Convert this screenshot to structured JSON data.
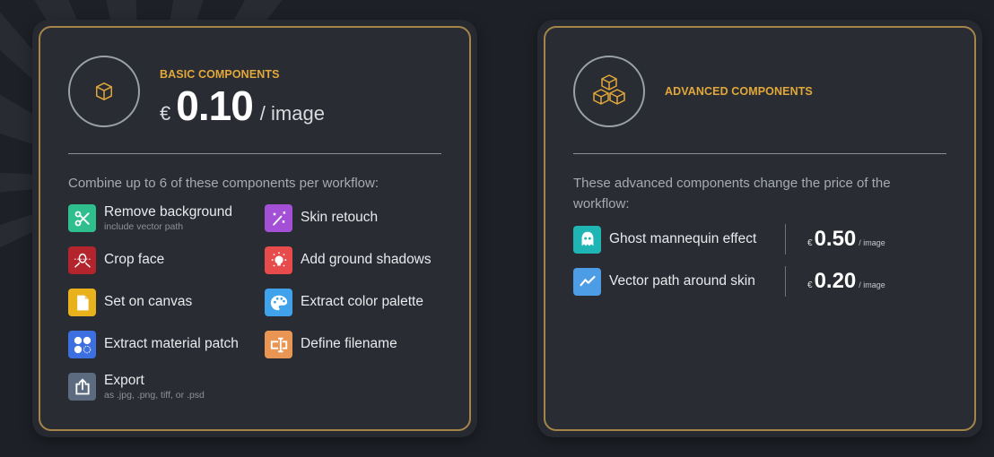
{
  "colors": {
    "accent_gold": "#e3a83a",
    "card_border": "#a5844a",
    "background": "#1d2026",
    "card_bg": "#292d33"
  },
  "basic": {
    "title": "BASIC COMPONENTS",
    "icon": "cube-icon",
    "currency": "€",
    "price": "0.10",
    "unit": "/ image",
    "description": "Combine up to 6 of these components per workflow:",
    "components": [
      {
        "label": "Remove background",
        "sublabel": "include vector path",
        "icon": "scissors-icon",
        "color": "#2fbf8f"
      },
      {
        "label": "Skin retouch",
        "sublabel": "",
        "icon": "magic-wand-icon",
        "color": "#a34fd6"
      },
      {
        "label": "Crop face",
        "sublabel": "",
        "icon": "face-crop-icon",
        "color": "#b3242c"
      },
      {
        "label": "Add ground shadows",
        "sublabel": "",
        "icon": "lightbulb-icon",
        "color": "#e84b4b"
      },
      {
        "label": "Set on canvas",
        "sublabel": "",
        "icon": "document-icon",
        "color": "#e9b21d"
      },
      {
        "label": "Extract color palette",
        "sublabel": "",
        "icon": "palette-icon",
        "color": "#3fa2ea"
      },
      {
        "label": "Extract material patch",
        "sublabel": "",
        "icon": "dots-grid-icon",
        "color": "#3c6fdf"
      },
      {
        "label": "Define filename",
        "sublabel": "",
        "icon": "text-cursor-icon",
        "color": "#e99654"
      },
      {
        "label": "Export",
        "sublabel": "as .jpg, .png, tiff, or .psd",
        "icon": "export-icon",
        "color": "#5c6b7f"
      }
    ]
  },
  "advanced": {
    "title": "ADVANCED COMPONENTS",
    "icon": "cubes-stack-icon",
    "description": "These advanced components change the price of the workflow:",
    "components": [
      {
        "label": "Ghost mannequin effect",
        "icon": "ghost-icon",
        "color": "#1fb5b5",
        "currency": "€",
        "price": "0.50",
        "unit": "/ image"
      },
      {
        "label": "Vector path around skin",
        "icon": "line-chart-icon",
        "color": "#4d9de6",
        "currency": "€",
        "price": "0.20",
        "unit": "/ image"
      }
    ]
  }
}
